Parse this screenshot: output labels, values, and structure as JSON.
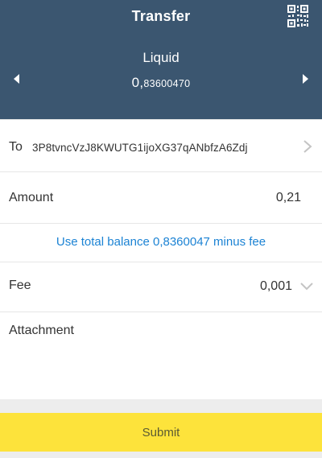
{
  "header": {
    "title": "Transfer",
    "asset_name": "Liquid",
    "balance_major": "0,",
    "balance_minor": "83600470"
  },
  "icons": {
    "qr": "qr-code-icon",
    "prev": "chevron-left-icon",
    "next": "chevron-right-icon",
    "to_chevron": "chevron-right-icon",
    "fee_chevron": "chevron-down-icon"
  },
  "form": {
    "to_label": "To",
    "to_address": "3P8tvncVzJ8KWUTG1ijoXG37qANbfzA6Zdj",
    "amount_label": "Amount",
    "amount_value": "0,21",
    "use_total_link": "Use total balance 0,8360047 minus fee",
    "fee_label": "Fee",
    "fee_value": "0,001",
    "attachment_label": "Attachment",
    "attachment_value": ""
  },
  "submit_label": "Submit",
  "colors": {
    "header_bg": "#3b5670",
    "link": "#1c83d4",
    "submit_bg": "#fde33b"
  }
}
